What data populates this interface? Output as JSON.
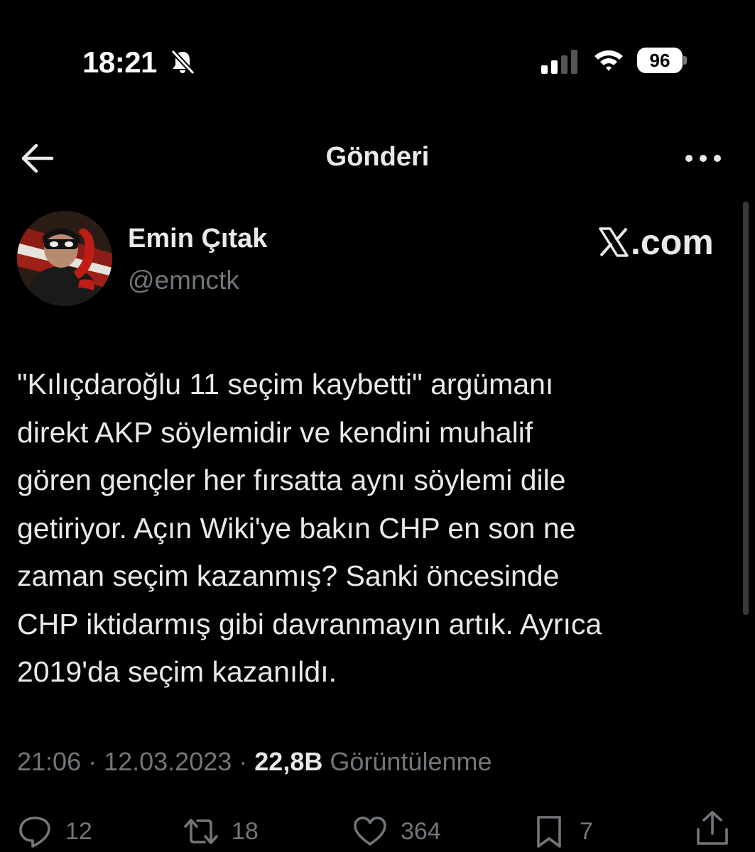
{
  "status_bar": {
    "time": "18:21",
    "battery": "96",
    "icons": [
      "bell-slash-icon",
      "signal-icon",
      "wifi-icon",
      "battery-icon"
    ]
  },
  "header": {
    "title": "Gönderi",
    "back_icon": "arrow-left-icon",
    "more_icon": "more-icon"
  },
  "author": {
    "name": "Emin Çıtak",
    "handle": "@emnctk",
    "watermark": ".com",
    "watermark_icon": "x-logo-icon"
  },
  "tweet": {
    "text": "\"Kılıçdaroğlu 11 seçim kaybetti\" argümanı\ndirekt AKP söylemidir ve kendini muhalif\ngören gençler her fırsatta aynı söylemi dile\ngetiriyor. Açın Wiki'ye bakın CHP en son ne\nzaman seçim kazanmış? Sanki öncesinde\nCHP iktidarmış gibi davranmayın artık. Ayrıca\n2019'da seçim kazanıldı."
  },
  "meta": {
    "time": "21:06",
    "sep1": " · ",
    "date": "12.03.2023",
    "sep2": " · ",
    "views": "22,8B",
    "views_label": " Görüntülenme"
  },
  "actions": {
    "replies": "12",
    "retweets": "18",
    "likes": "364",
    "bookmarks": "7"
  },
  "colors": {
    "background": "#000000",
    "text": "#e7e9ea",
    "muted": "#71767b"
  }
}
